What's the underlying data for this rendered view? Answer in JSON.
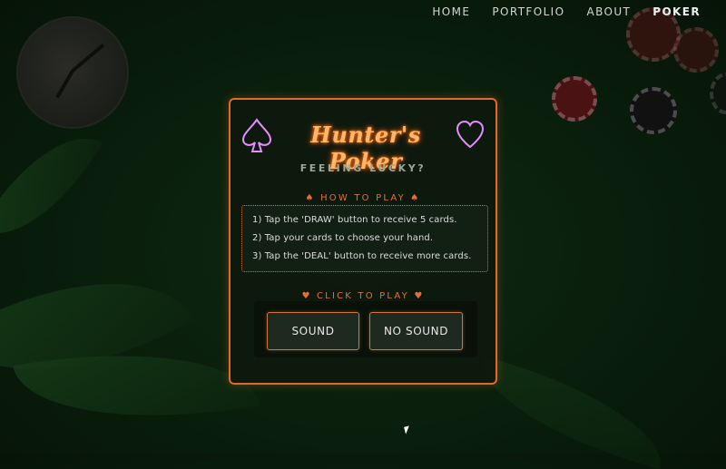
{
  "nav": {
    "items": [
      {
        "label": "HOME"
      },
      {
        "label": "PORTFOLIO"
      },
      {
        "label": "ABOUT"
      },
      {
        "label": "POKER"
      }
    ],
    "active": "POKER"
  },
  "logo": {
    "text": "Hunter's Poker"
  },
  "tagline": "FEELING LUCKY?",
  "how_to_play": {
    "title": "♠ HOW TO PLAY ♠",
    "steps": [
      "1) Tap the 'DRAW' button to receive 5 cards.",
      "2) Tap your cards to choose your hand.",
      "3) Tap the 'DEAL' button to receive more cards."
    ]
  },
  "click_to_play": {
    "title": "♥ CLICK TO PLAY ♥",
    "sound_label": "SOUND",
    "no_sound_label": "NO SOUND"
  },
  "colors": {
    "accent": "#e06a2a",
    "neon_logo": "#ffb86b",
    "neon_heart": "#e58cff"
  },
  "icons": [
    "spade-neon-icon",
    "heart-neon-icon",
    "mouse-cursor-icon"
  ]
}
